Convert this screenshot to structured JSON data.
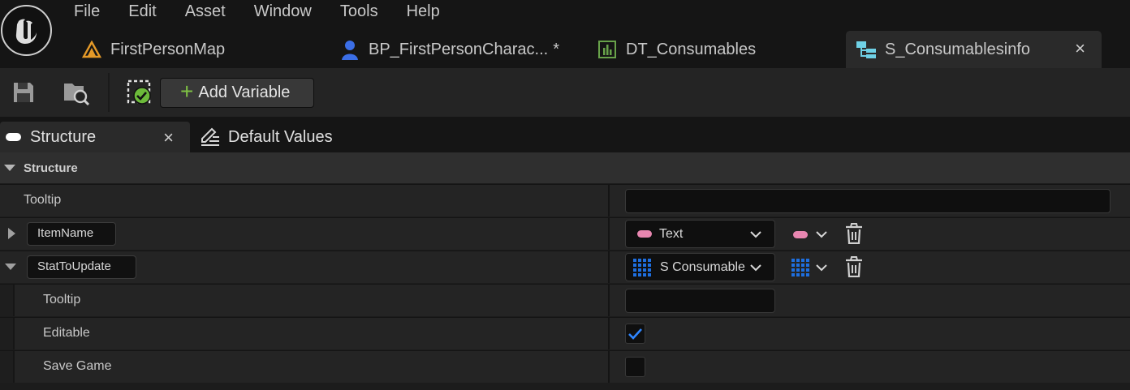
{
  "menu": [
    "File",
    "Edit",
    "Asset",
    "Window",
    "Tools",
    "Help"
  ],
  "tabs": [
    {
      "label": "FirstPersonMap",
      "icon": "level-icon"
    },
    {
      "label": "BP_FirstPersonCharac...",
      "icon": "character-blueprint-icon",
      "modified": "*"
    },
    {
      "label": "DT_Consumables",
      "icon": "datatable-icon"
    },
    {
      "label": "S_Consumablesinfo",
      "icon": "struct-icon",
      "active": true,
      "close": "×"
    }
  ],
  "toolbar": {
    "add_variable_label": "Add Variable",
    "add_icon": "+"
  },
  "panel_tabs": {
    "structure_label": "Structure",
    "structure_close": "×",
    "default_values_label": "Default Values"
  },
  "details": {
    "category": "Structure",
    "tooltip_label": "Tooltip",
    "tooltip_value": "",
    "members": [
      {
        "name": "ItemName",
        "type": "Text",
        "expanded": false,
        "type_color": "#e886b0"
      },
      {
        "name": "StatToUpdate",
        "type": "S Consumable",
        "expanded": true,
        "type_color": "#1e6fe0"
      }
    ],
    "sub_rows": {
      "tooltip_label": "Tooltip",
      "editable_label": "Editable",
      "editable_checked": true,
      "save_game_label": "Save Game",
      "save_game_checked": false
    }
  }
}
